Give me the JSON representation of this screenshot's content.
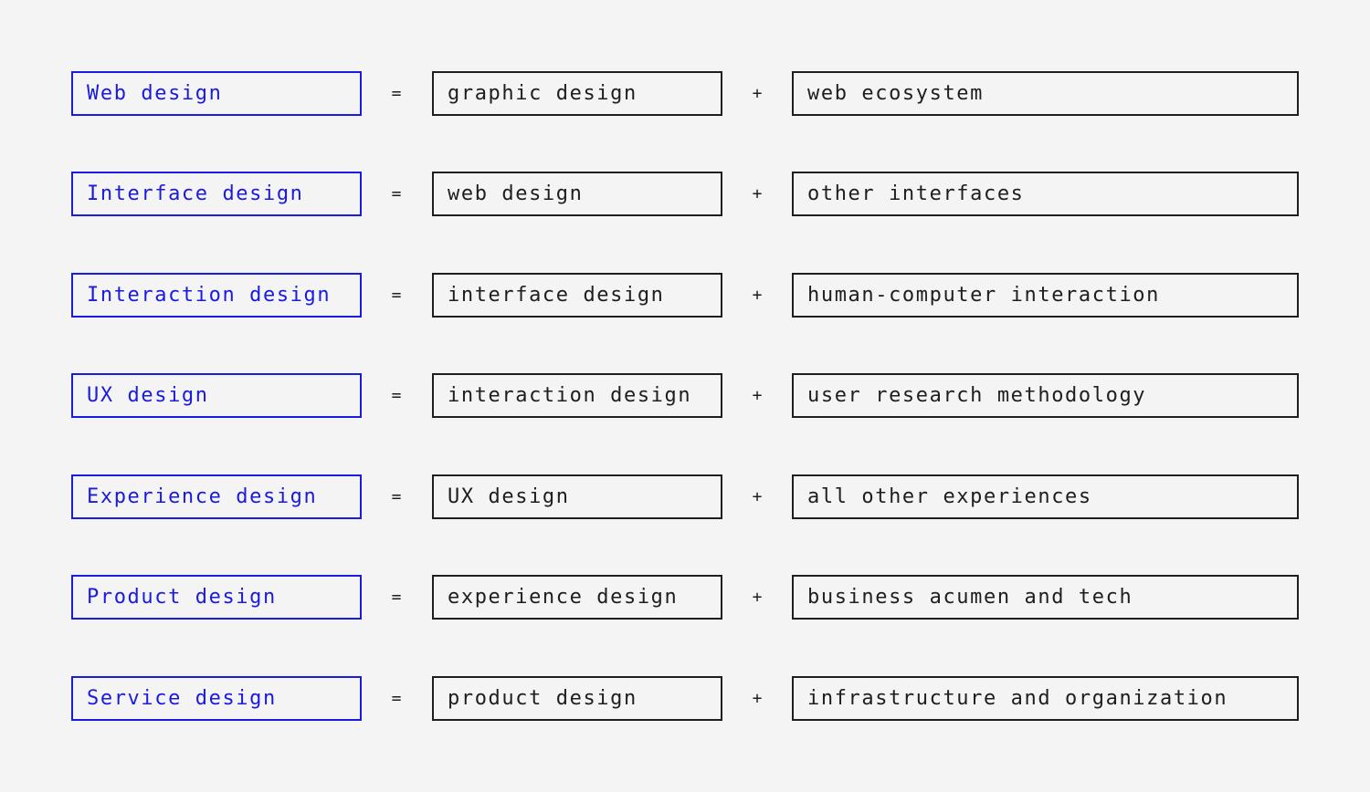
{
  "equations": [
    {
      "term": "Web design",
      "equals": "=",
      "base": "graphic design",
      "plus": "+",
      "addition": "web ecosystem"
    },
    {
      "term": "Interface design",
      "equals": "=",
      "base": "web design",
      "plus": "+",
      "addition": "other interfaces"
    },
    {
      "term": "Interaction design",
      "equals": "=",
      "base": "interface design",
      "plus": "+",
      "addition": "human-computer interaction"
    },
    {
      "term": "UX design",
      "equals": "=",
      "base": "interaction design",
      "plus": "+",
      "addition": "user research methodology"
    },
    {
      "term": "Experience design",
      "equals": "=",
      "base": "UX design",
      "plus": "+",
      "addition": "all other experiences"
    },
    {
      "term": "Product design",
      "equals": "=",
      "base": "experience design",
      "plus": "+",
      "addition": "business acumen and tech"
    },
    {
      "term": "Service design",
      "equals": "=",
      "base": "product design",
      "plus": "+",
      "addition": "infrastructure and organization"
    }
  ],
  "colors": {
    "term": "#1a1ae0",
    "ink": "#1e1e1e",
    "background": "#f4f4f4"
  }
}
